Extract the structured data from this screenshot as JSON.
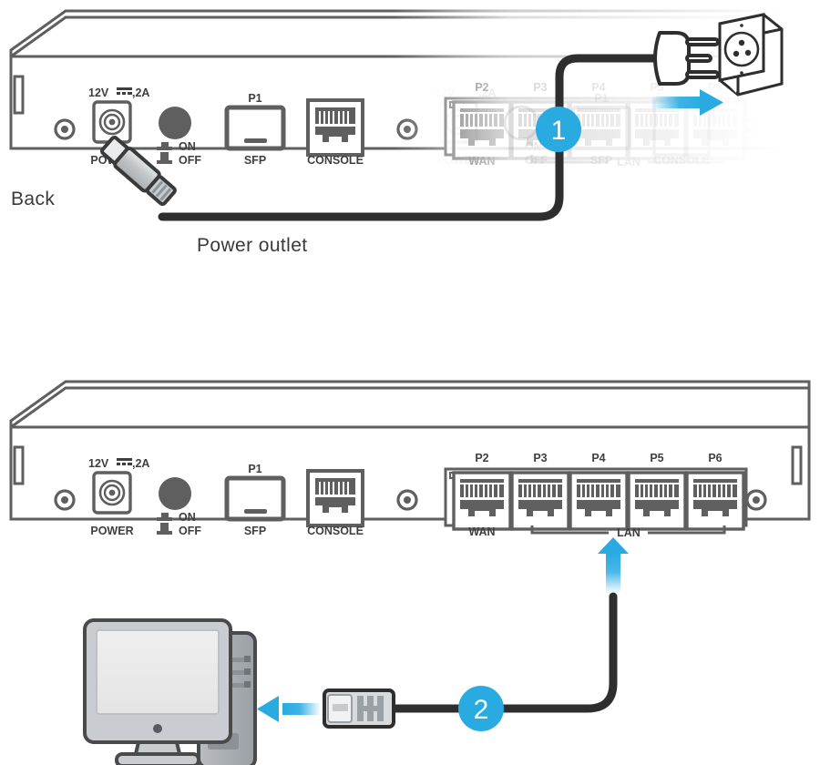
{
  "page": {
    "title": "Router hardware connection diagram",
    "background": "#ffffff"
  },
  "colors": {
    "accent_blue": "#29abe2",
    "outline_dark": "#333333",
    "outline_gray": "#5f5f5f",
    "label_text": "#404040",
    "cable_black": "#2e2e2e",
    "plug_gray": "#b4b8ba",
    "screen_gray": "#ececec",
    "tower_gray": "#a8adb2"
  },
  "steps": [
    {
      "number": "1",
      "action": "Connect power adapter to power outlet"
    },
    {
      "number": "2",
      "action": "Connect LAN port to computer"
    }
  ],
  "annotations": {
    "back_label": "Back",
    "power_outlet_label": "Power outlet"
  },
  "device": {
    "name": "Router rear panel",
    "power_rating": "12V",
    "power_rating_suffix": ",2A",
    "power_jack_label": "POWER",
    "switch": {
      "on_label": "ON",
      "off_label": "OFF"
    },
    "sfp": {
      "port_number": "P1",
      "label": "SFP"
    },
    "console": {
      "label": "CONSOLE"
    },
    "ethernet_ports": [
      {
        "port_number": "P2",
        "group": "WAN"
      },
      {
        "port_number": "P3",
        "group": "LAN"
      },
      {
        "port_number": "P4",
        "group": "LAN"
      },
      {
        "port_number": "P5",
        "group": "LAN"
      },
      {
        "port_number": "P6",
        "group": "LAN"
      }
    ],
    "group_labels": {
      "wan": "WAN",
      "lan": "LAN"
    }
  },
  "peripherals": {
    "wall_outlet": "AC wall socket",
    "computer": "Desktop computer"
  }
}
